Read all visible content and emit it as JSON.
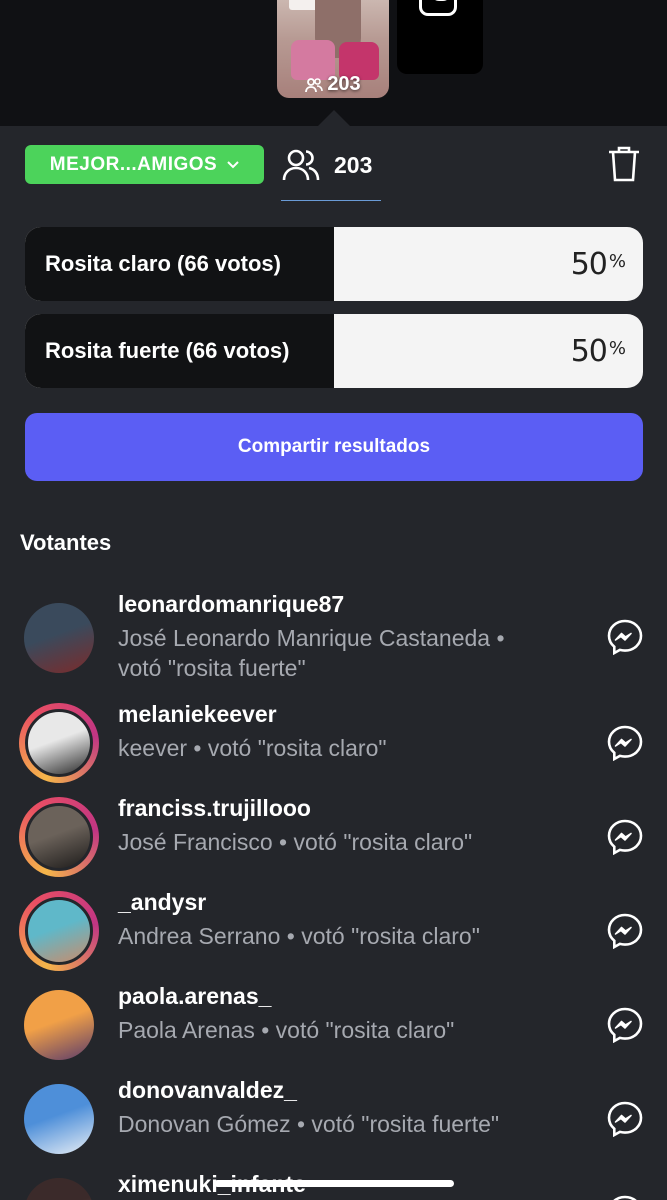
{
  "story": {
    "thumb_view_count": "203",
    "sticker_text": "Rosita fuerte"
  },
  "header": {
    "audience_label": "MEJOR...AMIGOS",
    "viewer_count": "203"
  },
  "poll": {
    "options": [
      {
        "label": "Rosita claro (66 votos)",
        "percent_value": "50",
        "percent_sign": "%",
        "fraction": 0.5
      },
      {
        "label": "Rosita fuerte (66 votos)",
        "percent_value": "50",
        "percent_sign": "%",
        "fraction": 0.5
      }
    ],
    "share_label": "Compartir resultados"
  },
  "voters_title": "Votantes",
  "voters": [
    {
      "username": "leonardomanrique87",
      "meta_line1": "José Leonardo Manrique Castaneda •",
      "meta_line2": "votó \"rosita fuerte\"",
      "story_ring": false,
      "avatar_colors": [
        "#3a4a5c",
        "#7b2b2b"
      ]
    },
    {
      "username": "melaniekeever",
      "meta_line1": "keever • votó \"rosita claro\"",
      "story_ring": true,
      "avatar_colors": [
        "#e8e8e8",
        "#2a2a2a"
      ]
    },
    {
      "username": "franciss.trujillooo",
      "meta_line1": "José Francisco • votó \"rosita claro\"",
      "story_ring": true,
      "avatar_colors": [
        "#6b625a",
        "#1d1b1a"
      ]
    },
    {
      "username": "_andysr",
      "meta_line1": "Andrea Serrano • votó \"rosita claro\"",
      "story_ring": true,
      "avatar_colors": [
        "#5fb8c9",
        "#c98c6c"
      ]
    },
    {
      "username": "paola.arenas_",
      "meta_line1": "Paola Arenas • votó \"rosita claro\"",
      "story_ring": false,
      "avatar_colors": [
        "#f1a047",
        "#5a3b6b"
      ]
    },
    {
      "username": "donovanvaldez_",
      "meta_line1": "Donovan Gómez • votó \"rosita fuerte\"",
      "story_ring": false,
      "avatar_colors": [
        "#4e8fd9",
        "#e8eef5"
      ]
    },
    {
      "username": "ximenuki_infante",
      "meta_line1": "",
      "story_ring": false,
      "avatar_colors": [
        "#3b2a2a",
        "#7a5a4a"
      ]
    }
  ],
  "colors": {
    "background": "#24262b",
    "audience_green": "#4cd35b",
    "share_blue": "#5b5ef4",
    "meta_grey": "#a6a9b0"
  }
}
